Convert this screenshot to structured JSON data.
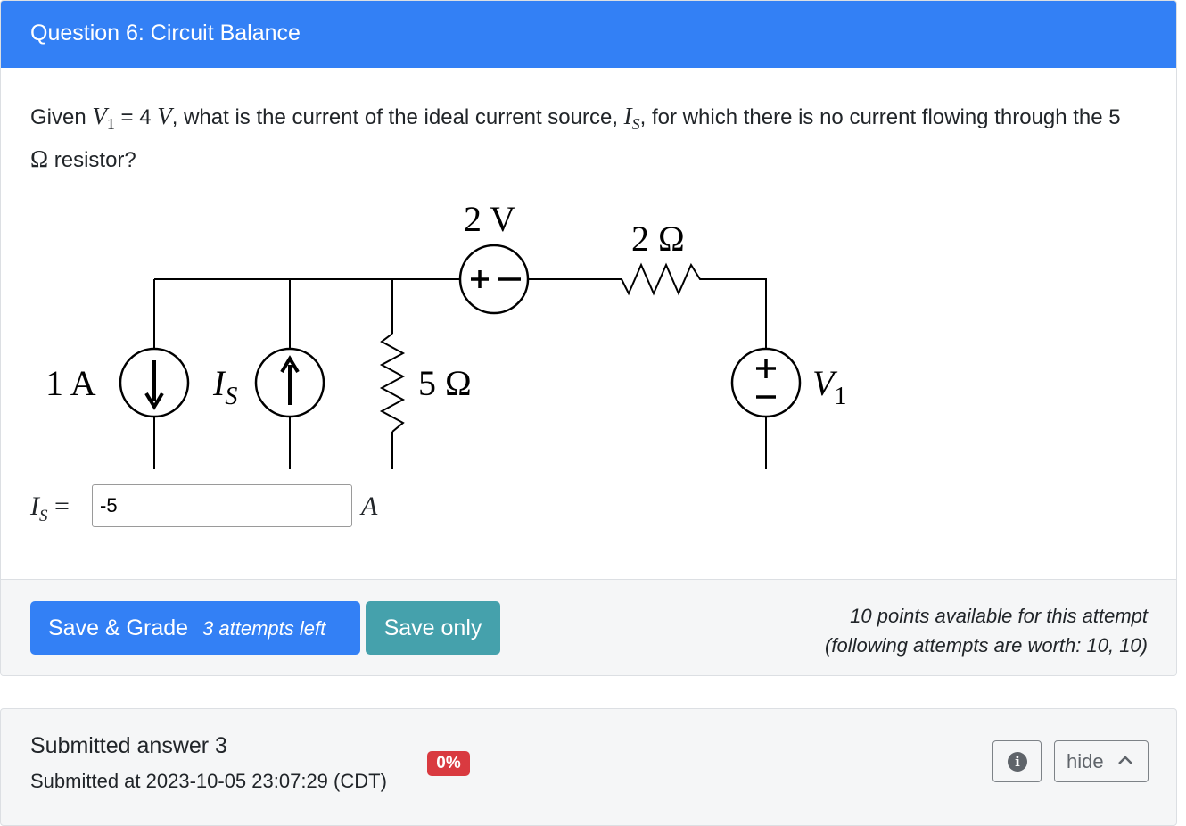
{
  "header": {
    "title": "Question 6: Circuit Balance"
  },
  "question": {
    "t1": "Given ",
    "v1_symbol": "V",
    "v1_sub": "1",
    "eq": " = 4 ",
    "v_unit": "V",
    "t2": ", what is the current of the ideal current source, ",
    "is_symbol": "I",
    "is_sub": "S",
    "t3": ", for which there is no current flowing through the 5 ",
    "ohm": "Ω",
    "t4": " resistor?"
  },
  "circuit": {
    "source_2v_label": "2 V",
    "resistor_2_label": "2 Ω",
    "current_1a_label": "1 A",
    "is_label": "I",
    "is_sub": "S",
    "resistor_5_label": "5 Ω",
    "v1_label": "V",
    "v1_sub": "1",
    "plus_minus": "+−",
    "plus": "+",
    "minus": "−"
  },
  "answer": {
    "lhs_symbol": "I",
    "lhs_sub": "S",
    "equals": " = ",
    "value": "-5",
    "unit": "A"
  },
  "footer": {
    "grade_label": "Save & Grade",
    "attempts_left": "3 attempts left",
    "save_only_label": "Save only",
    "points_line1": "10 points available for this attempt",
    "points_line2": "(following attempts are worth: 10, 10)"
  },
  "submission": {
    "title": "Submitted answer 3",
    "time": "Submitted at 2023-10-05 23:07:29 (CDT)",
    "score_badge": "0%",
    "info_icon": "i",
    "hide_label": "hide"
  },
  "colors": {
    "header_bg": "#3380f5",
    "grade_btn": "#3380f5",
    "save_btn": "#45a1ac",
    "badge_red": "#d93a40"
  }
}
